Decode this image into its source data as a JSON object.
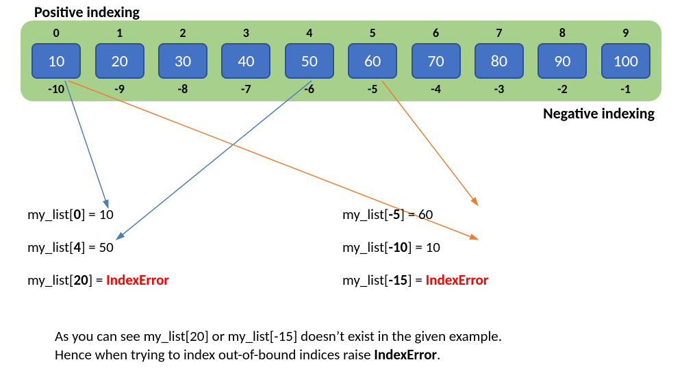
{
  "header": {
    "positive_label": "Positive indexing",
    "negative_label": "Negative indexing"
  },
  "list": {
    "cells": [
      {
        "pos": "0",
        "val": "10",
        "neg": "-10"
      },
      {
        "pos": "1",
        "val": "20",
        "neg": "-9"
      },
      {
        "pos": "2",
        "val": "30",
        "neg": "-8"
      },
      {
        "pos": "3",
        "val": "40",
        "neg": "-7"
      },
      {
        "pos": "4",
        "val": "50",
        "neg": "-6"
      },
      {
        "pos": "5",
        "val": "60",
        "neg": "-5"
      },
      {
        "pos": "6",
        "val": "70",
        "neg": "-4"
      },
      {
        "pos": "7",
        "val": "80",
        "neg": "-3"
      },
      {
        "pos": "8",
        "val": "90",
        "neg": "-2"
      },
      {
        "pos": "9",
        "val": "100",
        "neg": "-1"
      }
    ]
  },
  "examples_left": [
    {
      "pre": "my_list[",
      "idx": "0",
      "post": "] = ",
      "val": "10",
      "err": false
    },
    {
      "pre": "my_list[",
      "idx": "4",
      "post": "] = ",
      "val": "50",
      "err": false
    },
    {
      "pre": "my_list[",
      "idx": "20",
      "post": "] =  ",
      "val": "IndexError",
      "err": true
    }
  ],
  "examples_right": [
    {
      "pre": "my_list[",
      "idx": "-5",
      "post": "] = ",
      "val": "60",
      "err": false
    },
    {
      "pre": "my_list[",
      "idx": "-10",
      "post": "] = ",
      "val": "10",
      "err": false
    },
    {
      "pre": "my_list[",
      "idx": "-15",
      "post": "] = ",
      "val": "IndexError",
      "err": true
    }
  ],
  "footer": {
    "l1_a": "As you can see my_list[20] or my_list[-15] doesn’t exist in the given example.",
    "l2_a": "Hence when trying to index out-of-bound indices raise ",
    "l2_b": "IndexError",
    "l2_c": "."
  },
  "colors": {
    "arrow_blue": "#4a7ebb",
    "arrow_orange": "#ed7d31"
  }
}
